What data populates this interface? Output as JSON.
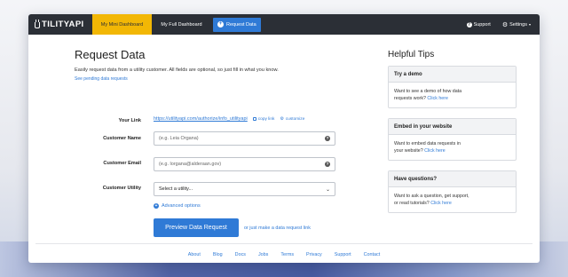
{
  "nav": {
    "logo_text": "TILITYAPI",
    "tabs": [
      {
        "label": "My Mini Dashboard"
      },
      {
        "label": "My Full Dashboard"
      },
      {
        "label": "Request Data"
      }
    ],
    "support": "Support",
    "settings": "Settings"
  },
  "main": {
    "title": "Request Data",
    "intro": "Easily request data from a utility customer. All fields are optional, so just fill in what you know.",
    "pending_link": "See pending data requests",
    "your_link_label": "Your Link",
    "your_link_url": "https://utilityapi.com/authorize/info_utilityapi",
    "copy_link": "copy link",
    "customize": "customize",
    "customer_name_label": "Customer Name",
    "customer_name_placeholder": "(e.g. Leia Organa)",
    "customer_email_label": "Customer Email",
    "customer_email_placeholder": "(e.g. lorgana@alderaan.gov)",
    "customer_utility_label": "Customer Utility",
    "customer_utility_value": "Select a utility...",
    "advanced_options": "Advanced options",
    "preview_button": "Preview Data Request",
    "or_link": "or just make a data request link"
  },
  "tips": {
    "title": "Helpful Tips",
    "cards": [
      {
        "head": "Try a demo",
        "line1": "Want to see a demo of how data",
        "line2_pre": "requests work? ",
        "link": "Click here"
      },
      {
        "head": "Embed in your website",
        "line1": "Want to embed data requests in",
        "line2_pre": "your website? ",
        "link": "Click here"
      },
      {
        "head": "Have questions?",
        "line1": "Want to ask a question, get support,",
        "line2_pre": "or read tutorials? ",
        "link": "Click here"
      }
    ]
  },
  "footer": {
    "links": [
      "About",
      "Blog",
      "Docs",
      "Jobs",
      "Terms",
      "Privacy",
      "Support",
      "Contact"
    ]
  },
  "colors": {
    "accent": "#2f7ad6",
    "nav_bg": "#2b2f36",
    "active_tab": "#f2b705"
  }
}
